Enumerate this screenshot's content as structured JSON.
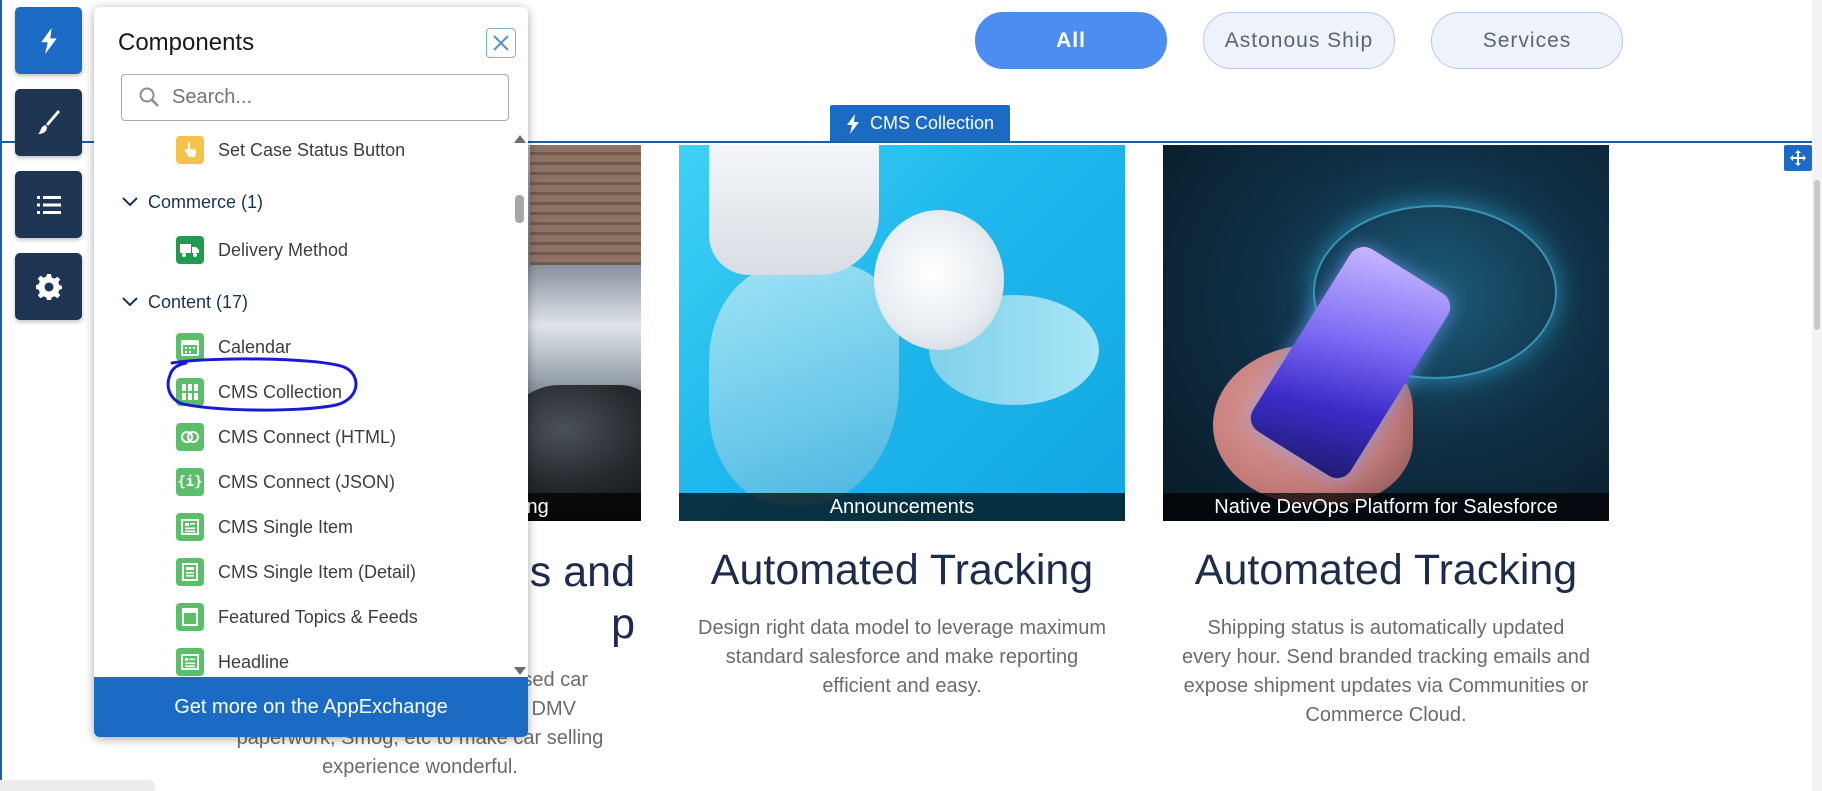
{
  "canvas": {
    "tabs": [
      {
        "label": "All",
        "active": true
      },
      {
        "label": "Astonous Ship",
        "active": false
      },
      {
        "label": "Services",
        "active": false
      }
    ],
    "cms_collection_label": "CMS Collection",
    "cards": [
      {
        "caption": "ing",
        "title": "s and",
        "title2": "p",
        "desc_lines": [
          "sed car",
          "DMV",
          "paperwork, Smog, etc to make car selling",
          "experience wonderful."
        ]
      },
      {
        "caption": "Announcements",
        "title": "Automated Tracking",
        "desc_lines": [
          "Design right data model to leverage maximum",
          "standard salesforce and make reporting",
          "efficient and easy."
        ]
      },
      {
        "caption": "Native DevOps Platform for Salesforce",
        "title": "Automated Tracking",
        "desc_lines": [
          "Shipping status is automatically updated",
          "every hour. Send branded tracking emails and",
          "expose shipment updates via Communities or",
          "Commerce Cloud."
        ]
      }
    ]
  },
  "toolbar": {
    "items": [
      {
        "icon": "lightning-icon",
        "active": true
      },
      {
        "icon": "brush-icon",
        "active": false
      },
      {
        "icon": "list-icon",
        "active": false
      },
      {
        "icon": "gear-icon",
        "active": false
      }
    ]
  },
  "panel": {
    "title": "Components",
    "search_placeholder": "Search...",
    "list": [
      {
        "type": "item",
        "label": "Set Case Status Button",
        "icon": "hand-pointer-icon",
        "color": "#f6c24a"
      },
      {
        "type": "category",
        "label": "Commerce (1)"
      },
      {
        "type": "item",
        "label": "Delivery Method",
        "icon": "truck-icon",
        "color": "#1f9a4e"
      },
      {
        "type": "category",
        "label": "Content (17)"
      },
      {
        "type": "item",
        "label": "Calendar",
        "icon": "calendar-icon",
        "color": "#5bbf6a"
      },
      {
        "type": "item",
        "label": "CMS Collection",
        "icon": "grid-icon",
        "color": "#5bbf6a"
      },
      {
        "type": "item",
        "label": "CMS Connect (HTML)",
        "icon": "connect-icon",
        "color": "#5bbf6a"
      },
      {
        "type": "item",
        "label": "CMS Connect (JSON)",
        "icon": "braces-icon",
        "color": "#5bbf6a"
      },
      {
        "type": "item",
        "label": "CMS Single Item",
        "icon": "article-icon",
        "color": "#5bbf6a"
      },
      {
        "type": "item",
        "label": "CMS Single Item (Detail)",
        "icon": "article-detail-icon",
        "color": "#5bbf6a"
      },
      {
        "type": "item",
        "label": "Featured Topics & Feeds",
        "icon": "topics-icon",
        "color": "#5bbf6a"
      },
      {
        "type": "item",
        "label": "Headline",
        "icon": "headline-icon",
        "color": "#5bbf6a"
      }
    ],
    "footer_label": "Get more on the AppExchange"
  },
  "colors": {
    "brand": "#1b6bc4",
    "toolbar_bg": "#1e3553",
    "tab_active": "#4c8ef0",
    "annotation": "#1a1ad4"
  }
}
